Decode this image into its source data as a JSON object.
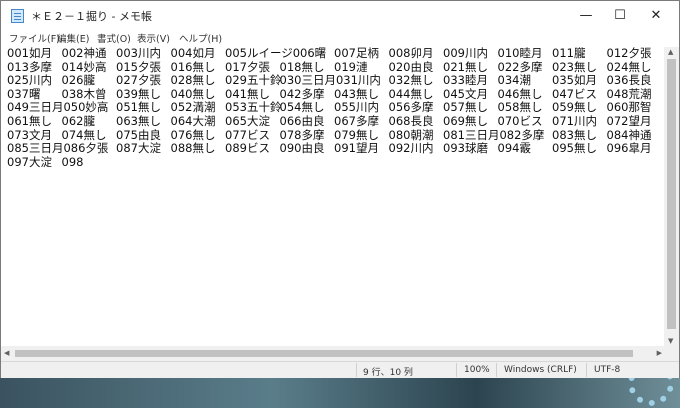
{
  "window": {
    "title": "＊Ｅ２－１掘り - メモ帳"
  },
  "menu": [
    "ファイル(F)",
    "編集(E)",
    "書式(O)",
    "表示(V)",
    "ヘルプ(H)"
  ],
  "rows": [
    [
      "001如月",
      "002神通",
      "003川内",
      "004如月",
      "005ルイージ006曙",
      "007足柄",
      "008卯月",
      "009川内",
      "010睦月",
      "011朧",
      "012夕張"
    ],
    [
      "013多摩",
      "014妙高",
      "015夕張",
      "016無し",
      "017夕張",
      "018無し",
      "019漣",
      "020由良",
      "021無し",
      "022多摩",
      "023無し",
      "024無し"
    ],
    [
      "025川内",
      "026朧",
      "027夕張",
      "028無し",
      "029五十鈴",
      "030三日月031川内",
      "032無し",
      "033睦月",
      "034潮",
      "035如月",
      "036長良"
    ],
    [
      "037曙",
      "038木曾",
      "039無し",
      "040無し",
      "041無し",
      "042多摩",
      "043無し",
      "044無し",
      "045文月",
      "046無し",
      "047ビス",
      "048荒潮"
    ],
    [
      "049三日月050妙高",
      "051無し",
      "052満潮",
      "053五十鈴",
      "054無し",
      "055川内",
      "056多摩",
      "057無し",
      "058無し",
      "059無し",
      "060那智"
    ],
    [
      "061無し",
      "062朧",
      "063無し",
      "064大潮",
      "065大淀",
      "066由良",
      "067多摩",
      "068長良",
      "069無し",
      "070ビス",
      "071川内",
      "072望月"
    ],
    [
      "073文月",
      "074無し",
      "075由良",
      "076無し",
      "077ビス",
      "078多摩",
      "079無し",
      "080朝潮",
      "081三日月082多摩",
      "083無し",
      "084神通"
    ],
    [
      "085三日月086夕張",
      "087大淀",
      "088無し",
      "089ビス",
      "090由良",
      "091望月",
      "092川内",
      "093球磨",
      "094霰",
      "095無し",
      "096皐月"
    ],
    [
      "097大淀",
      "098"
    ]
  ],
  "status": {
    "position": "9 行、10 列",
    "zoom": "100%",
    "line_ending": "Windows (CRLF)",
    "encoding": "UTF-8"
  },
  "icons": {
    "app": "notepad-icon",
    "minimize": "minimize-icon",
    "maximize": "maximize-icon",
    "close": "close-icon"
  }
}
